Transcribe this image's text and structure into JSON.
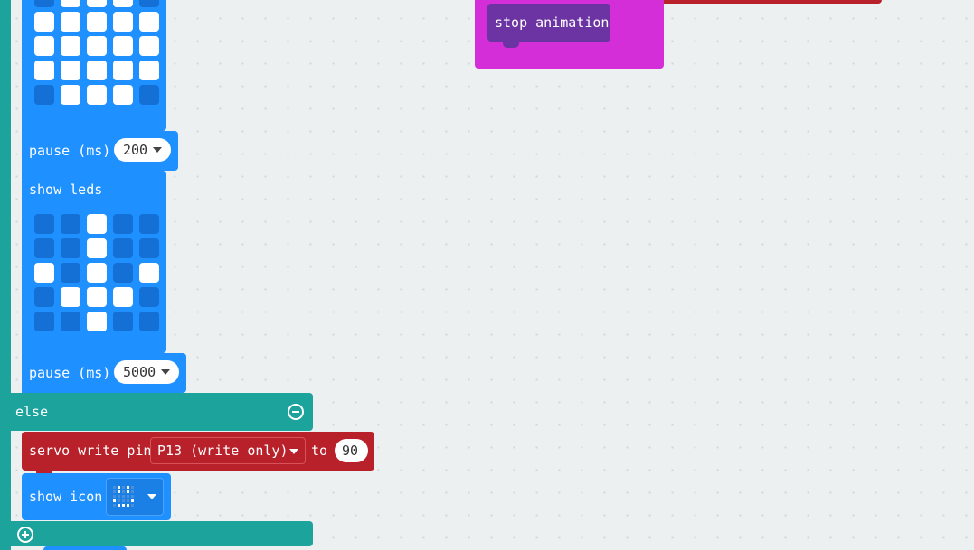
{
  "blocks": {
    "pause1": {
      "label": "pause (ms)",
      "value": "200"
    },
    "show_leds": {
      "label": "show leds"
    },
    "pause2": {
      "label": "pause (ms)",
      "value": "5000"
    },
    "else_label": "else",
    "servo": {
      "prefix": "servo write pin",
      "pin": "P13 (write only)",
      "to": "to",
      "value": "90"
    },
    "show_icon": {
      "label": "show icon"
    },
    "stop_animation": {
      "label": "stop animation"
    }
  },
  "leds_grid_top": [
    [
      0,
      1,
      1,
      1,
      0
    ],
    [
      1,
      1,
      1,
      1,
      1
    ],
    [
      1,
      1,
      1,
      1,
      1
    ],
    [
      1,
      1,
      1,
      1,
      1
    ],
    [
      0,
      1,
      1,
      1,
      0
    ]
  ],
  "leds_grid_bottom": [
    [
      0,
      0,
      1,
      0,
      0
    ],
    [
      0,
      0,
      1,
      0,
      0
    ],
    [
      1,
      0,
      1,
      0,
      1
    ],
    [
      0,
      1,
      1,
      1,
      0
    ],
    [
      0,
      0,
      1,
      0,
      0
    ]
  ],
  "colors": {
    "workspace": "#ecf0f1",
    "logic": "#1ba39c",
    "basic": "#1e90ff",
    "pins": "#b8202a",
    "music": "#6c34a3",
    "loops": "#d42ed9"
  }
}
